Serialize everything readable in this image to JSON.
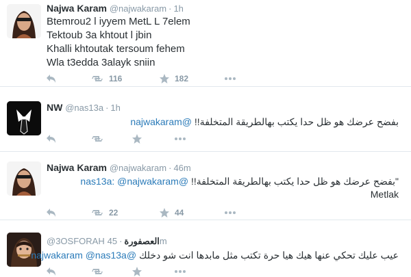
{
  "tweets": [
    {
      "name": "Najwa Karam",
      "handle": "@najwakaram",
      "time": "1h",
      "lines": [
        "Btemrou2 l iyyem MetL L 7elem",
        "Tektoub 3a khtout l jbin",
        "Khalli khtoutak tersoum fehem",
        "Wla t3edda 3alayk  sniin"
      ],
      "retweets": "116",
      "favorites": "182"
    },
    {
      "name": "NW",
      "handle": "@nas13a",
      "time": "1h",
      "mention": "@najwakaram",
      "text": "بفضح عرضك هو ظل حدا يكتب بهالطريقة المتخلفة!!",
      "retweets": "",
      "favorites": ""
    },
    {
      "name": "Najwa Karam",
      "handle": "@najwakaram",
      "time": "46m",
      "quote_mentions": "@nas13a: @najwakaram",
      "quote_text": "\"بفضح عرضك هو ظل حدا يكتب بهالطريقة المتخلفة!!",
      "reply": "Metlak",
      "retweets": "22",
      "favorites": "44"
    },
    {
      "name": "العصفورة",
      "handle": "@3OSFORAH",
      "time": "45m",
      "mentions": "@najwakaram @nas13a",
      "text": "عيب عليك تحكي عنها هيك هيا حرة تكتب مثل مابدها انت شو دخلك"
    }
  ],
  "icons": {
    "reply": "reply-arrow-icon",
    "retweet": "retweet-icon",
    "favorite": "star-icon",
    "more": "more-dots-icon"
  },
  "colors": {
    "mention": "#2b7bb9",
    "meta": "#8899a6",
    "text": "#292f33",
    "icon": "#aab8c2"
  }
}
